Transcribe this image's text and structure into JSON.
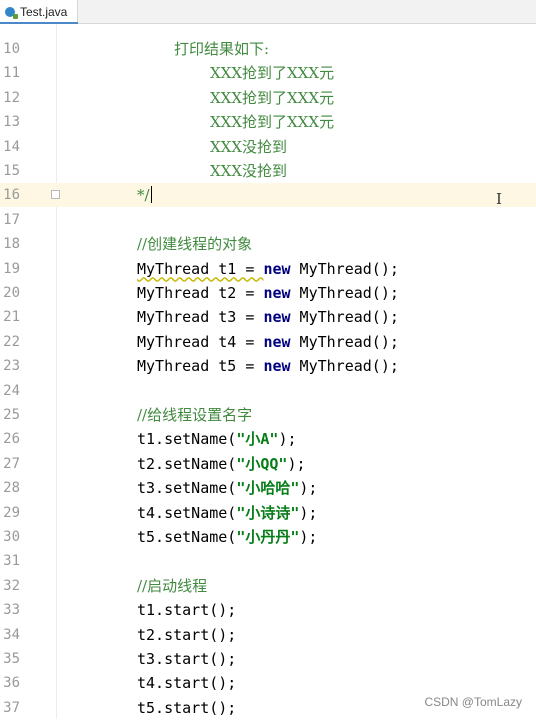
{
  "tab": {
    "filename": "Test.java"
  },
  "lines": [
    {
      "num": "10",
      "text": "打印结果如下:",
      "type": "comment",
      "indent": 174
    },
    {
      "num": "11",
      "text": "XXX抢到了XXX元",
      "type": "comment",
      "indent": 210
    },
    {
      "num": "12",
      "text": "XXX抢到了XXX元",
      "type": "comment",
      "indent": 210
    },
    {
      "num": "13",
      "text": "XXX抢到了XXX元",
      "type": "comment",
      "indent": 210
    },
    {
      "num": "14",
      "text": "XXX没抢到",
      "type": "comment",
      "indent": 210
    },
    {
      "num": "15",
      "text": "XXX没抢到",
      "type": "comment",
      "indent": 210
    },
    {
      "num": "16",
      "text": "*/",
      "type": "comment",
      "indent": 137
    },
    {
      "num": "17",
      "text": "",
      "type": "blank"
    },
    {
      "num": "18",
      "text": "//创建线程的对象",
      "type": "comment",
      "indent": 137
    },
    {
      "num": "19",
      "var": "MyThread t1 = ",
      "kw": "new",
      "rest": " MyThread();",
      "type": "decl"
    },
    {
      "num": "20",
      "var": "MyThread t2 = ",
      "kw": "new",
      "rest": " MyThread();",
      "type": "decl"
    },
    {
      "num": "21",
      "var": "MyThread t3 = ",
      "kw": "new",
      "rest": " MyThread();",
      "type": "decl"
    },
    {
      "num": "22",
      "var": "MyThread t4 = ",
      "kw": "new",
      "rest": " MyThread();",
      "type": "decl"
    },
    {
      "num": "23",
      "var": "MyThread t5 = ",
      "kw": "new",
      "rest": " MyThread();",
      "type": "decl"
    },
    {
      "num": "24",
      "text": "",
      "type": "blank"
    },
    {
      "num": "25",
      "text": "//给线程设置名字",
      "type": "comment",
      "indent": 137
    },
    {
      "num": "26",
      "pre": "t1.setName(",
      "str": "\"小A\"",
      "post": ");",
      "type": "call"
    },
    {
      "num": "27",
      "pre": "t2.setName(",
      "str": "\"小QQ\"",
      "post": ");",
      "type": "call"
    },
    {
      "num": "28",
      "pre": "t3.setName(",
      "str": "\"小哈哈\"",
      "post": ");",
      "type": "call"
    },
    {
      "num": "29",
      "pre": "t4.setName(",
      "str": "\"小诗诗\"",
      "post": ");",
      "type": "call"
    },
    {
      "num": "30",
      "pre": "t5.setName(",
      "str": "\"小丹丹\"",
      "post": ");",
      "type": "call"
    },
    {
      "num": "31",
      "text": "",
      "type": "blank"
    },
    {
      "num": "32",
      "text": "//启动线程",
      "type": "comment",
      "indent": 137
    },
    {
      "num": "33",
      "text": "t1.start();",
      "type": "code"
    },
    {
      "num": "34",
      "text": "t2.start();",
      "type": "code"
    },
    {
      "num": "35",
      "text": "t3.start();",
      "type": "code"
    },
    {
      "num": "36",
      "text": "t4.start();",
      "type": "code"
    },
    {
      "num": "37",
      "text": "t5.start();",
      "type": "code"
    }
  ],
  "watermark": "CSDN @TomLazy"
}
